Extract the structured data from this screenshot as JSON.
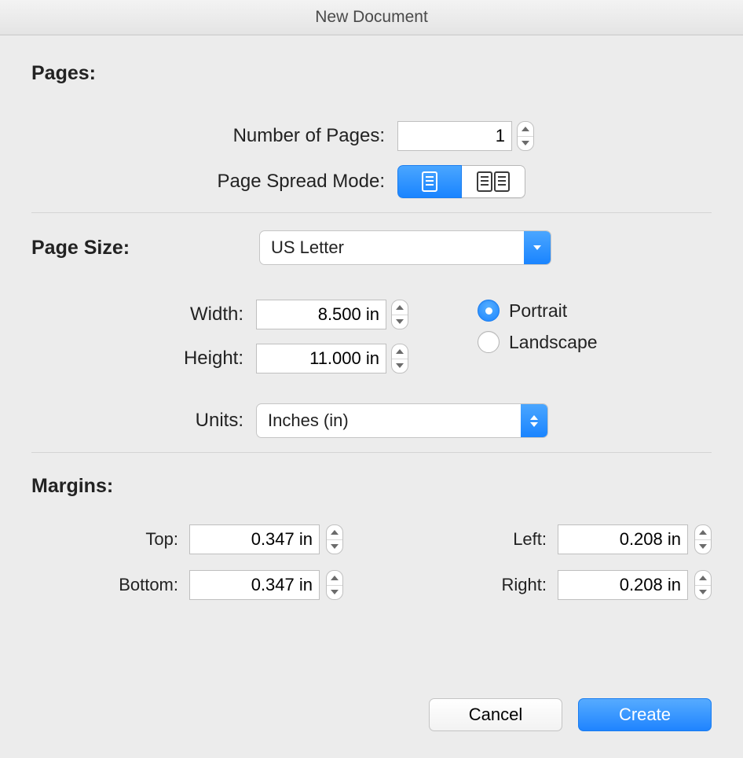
{
  "window": {
    "title": "New Document"
  },
  "pages": {
    "section_label": "Pages:",
    "number_of_pages_label": "Number of Pages:",
    "number_of_pages_value": "1",
    "spread_mode_label": "Page Spread Mode:",
    "spread_mode": "single"
  },
  "page_size": {
    "section_label": "Page Size:",
    "preset": "US Letter",
    "width_label": "Width:",
    "width_value": "8.500 in",
    "height_label": "Height:",
    "height_value": "11.000 in",
    "units_label": "Units:",
    "units_value": "Inches (in)",
    "orientation": {
      "portrait_label": "Portrait",
      "landscape_label": "Landscape",
      "selected": "portrait"
    }
  },
  "margins": {
    "section_label": "Margins:",
    "top_label": "Top:",
    "top_value": "0.347 in",
    "bottom_label": "Bottom:",
    "bottom_value": "0.347 in",
    "left_label": "Left:",
    "left_value": "0.208 in",
    "right_label": "Right:",
    "right_value": "0.208 in"
  },
  "footer": {
    "cancel_label": "Cancel",
    "create_label": "Create"
  }
}
